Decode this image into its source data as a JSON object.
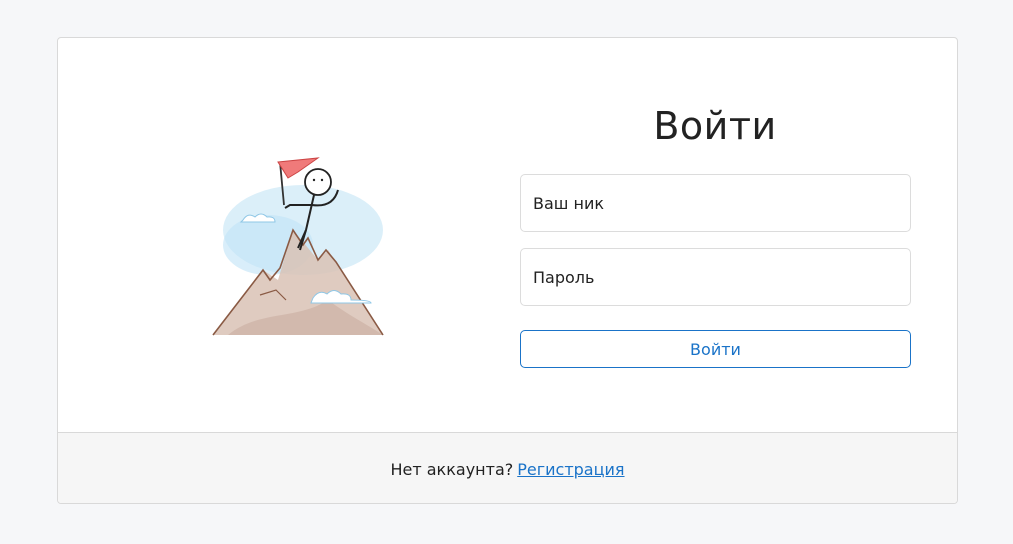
{
  "login": {
    "title": "Войти",
    "nick_placeholder": "Ваш ник",
    "password_placeholder": "Пароль",
    "submit_label": "Войти"
  },
  "footer": {
    "prompt": "Нет аккаунта?",
    "register_link": "Регистрация"
  },
  "colors": {
    "accent": "#1a73c8",
    "flag": "#f07a7a"
  },
  "illustration": {
    "icon": "mountain-climber-icon"
  }
}
